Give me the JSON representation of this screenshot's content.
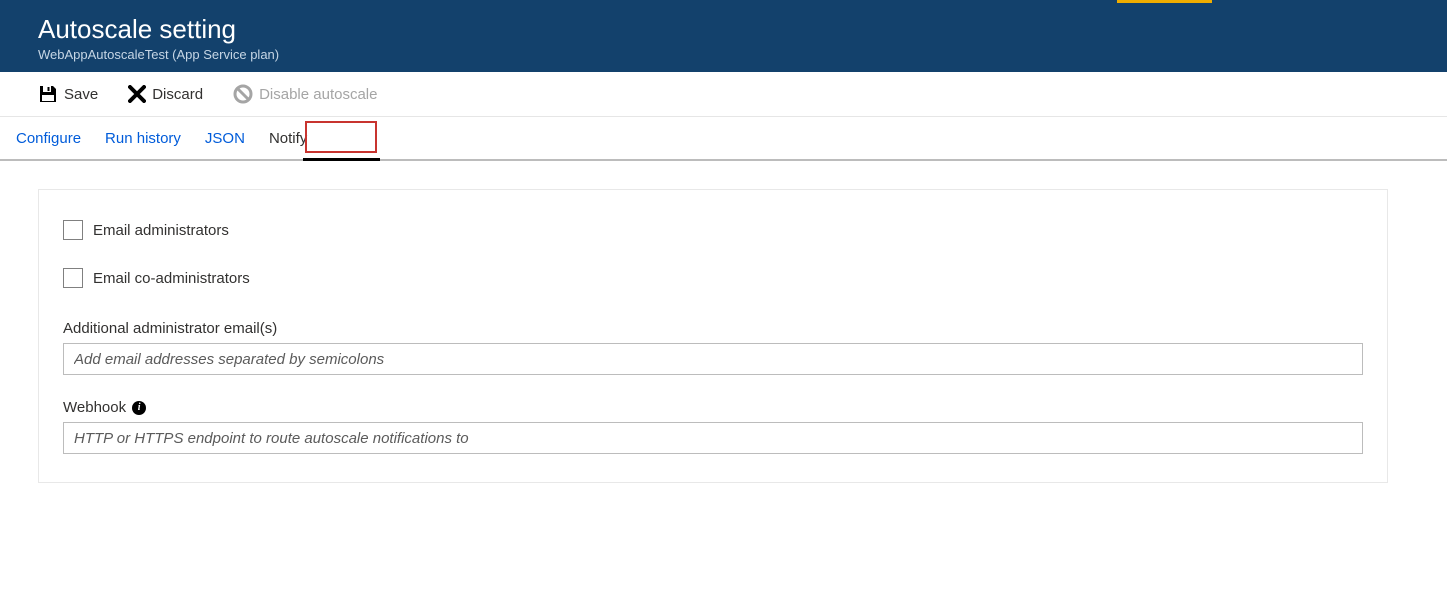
{
  "header": {
    "title": "Autoscale setting",
    "subtitle": "WebAppAutoscaleTest (App Service plan)"
  },
  "toolbar": {
    "save_label": "Save",
    "discard_label": "Discard",
    "disable_label": "Disable autoscale"
  },
  "tabs": {
    "configure": "Configure",
    "run_history": "Run history",
    "json": "JSON",
    "notify": "Notify"
  },
  "form": {
    "email_admins_label": "Email administrators",
    "email_coadmins_label": "Email co-administrators",
    "additional_emails_label": "Additional administrator email(s)",
    "additional_emails_placeholder": "Add email addresses separated by semicolons",
    "webhook_label": "Webhook",
    "webhook_placeholder": "HTTP or HTTPS endpoint to route autoscale notifications to"
  }
}
